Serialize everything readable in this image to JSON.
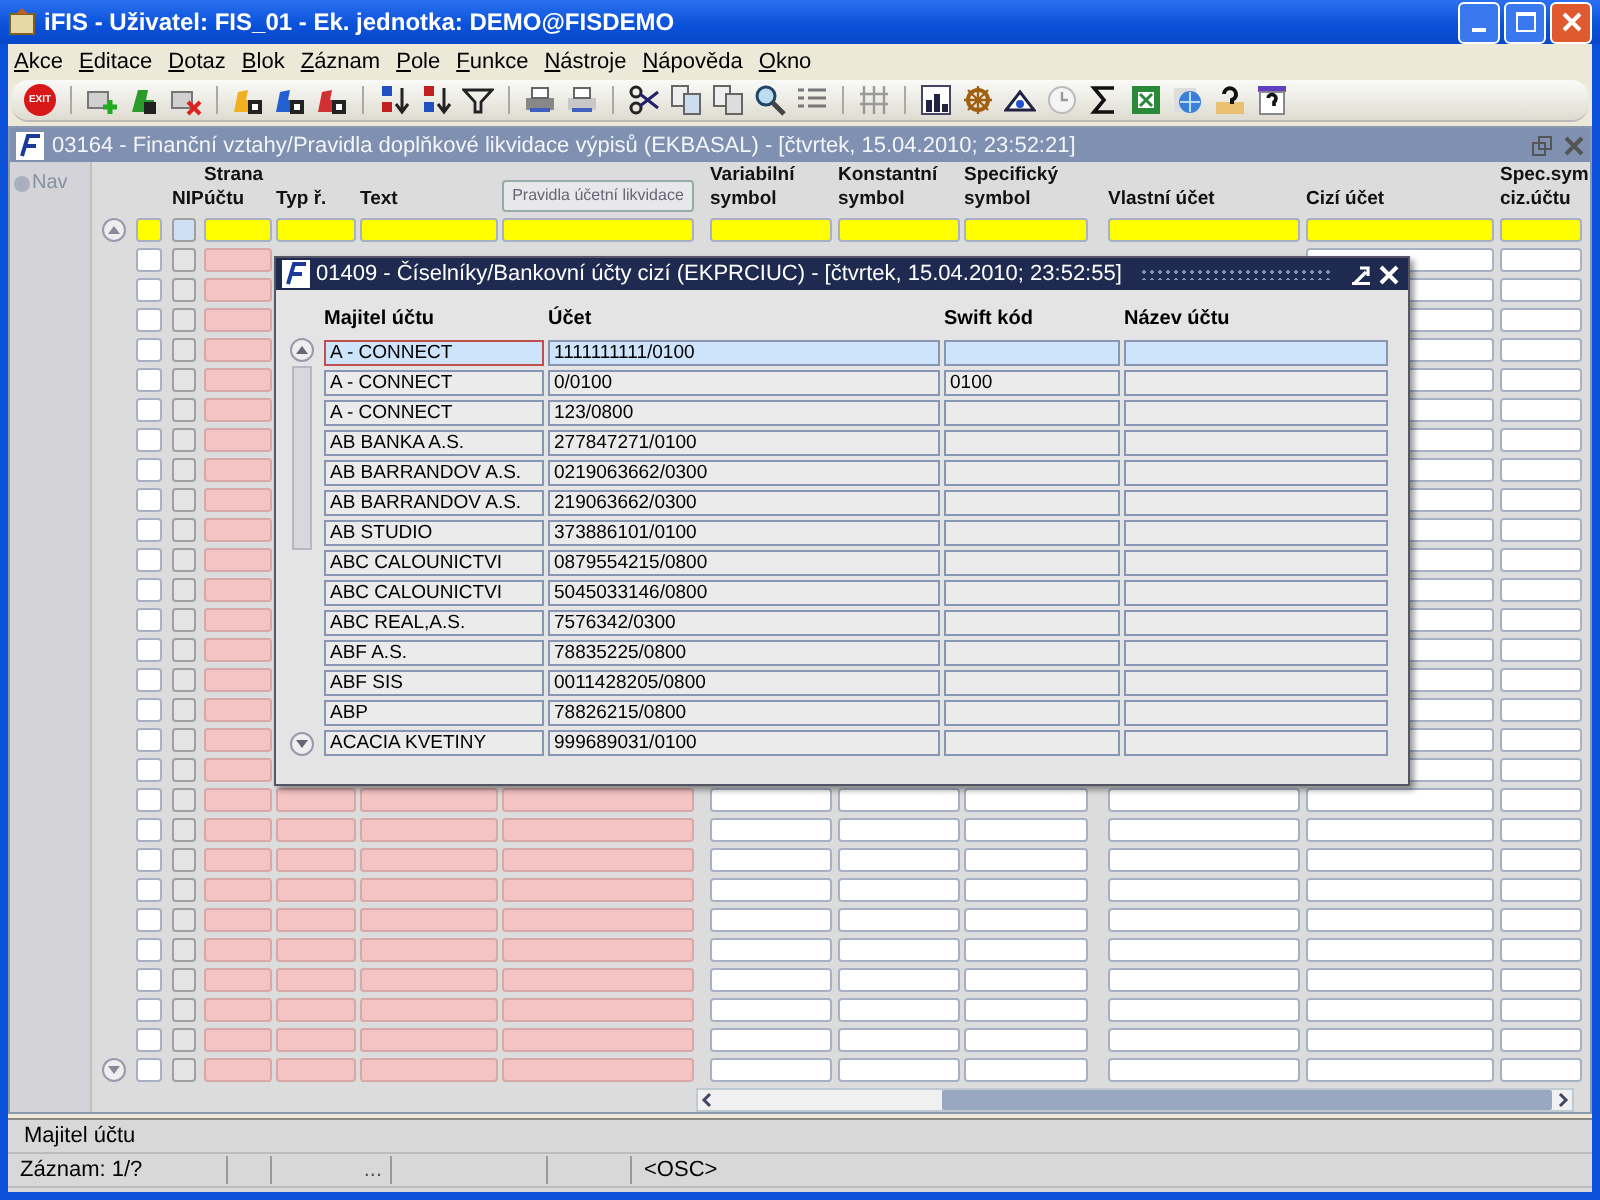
{
  "window": {
    "title": "iFIS - Uživatel: FIS_01 - Ek. jednotka: DEMO@FISDEMO"
  },
  "menu": [
    "Akce",
    "Editace",
    "Dotaz",
    "Blok",
    "Záznam",
    "Pole",
    "Funkce",
    "Nástroje",
    "Nápověda",
    "Okno"
  ],
  "toolbar": {
    "exit_label": "EXIT"
  },
  "form": {
    "title": "03164 - Finanční vztahy/Pravidla doplňkové likvidace výpisů (EKBASAL) - [čtvrtek, 15.04.2010; 23:52:21]",
    "rows": [
      {
        "checked": false
      },
      {
        "checked": false
      },
      {
        "checked": false
      },
      {
        "checked": false
      },
      {
        "checked": false
      },
      {
        "checked": false
      },
      {
        "checked": false
      },
      {
        "checked": false
      },
      {
        "checked": false
      },
      {
        "checked": false
      },
      {
        "checked": false
      },
      {
        "checked": false
      },
      {
        "checked": false
      },
      {
        "checked": false
      },
      {
        "checked": false
      },
      {
        "checked": false
      },
      {
        "checked": false
      },
      {
        "checked": false
      },
      {
        "checked": false
      },
      {
        "checked": false
      },
      {
        "checked": false
      },
      {
        "checked": false
      },
      {
        "checked": false
      },
      {
        "checked": false
      },
      {
        "checked": false
      },
      {
        "checked": false
      },
      {
        "checked": false
      },
      {
        "checked": false
      }
    ],
    "nav_label": "Nav",
    "columns": [
      {
        "label": "NIP",
        "kind": "checkbox"
      },
      {
        "label": "Strana účtu",
        "kind": "required"
      },
      {
        "label": "Typ ř.",
        "kind": "required"
      },
      {
        "label": "Text",
        "kind": "required"
      },
      {
        "label": "Pravidla účetní likvidace",
        "kind": "button"
      },
      {
        "label": "Variabilní symbol",
        "kind": "field"
      },
      {
        "label": "Konstantní symbol",
        "kind": "field"
      },
      {
        "label": "Specifický symbol",
        "kind": "field"
      },
      {
        "label": "Vlastní účet",
        "kind": "field"
      },
      {
        "label": "Cizí účet",
        "kind": "field"
      },
      {
        "label": "Spec.sym ciz.účtu",
        "kind": "field"
      }
    ]
  },
  "dialog": {
    "title": "01409 - Číselníky/Bankovní účty cizí (EKPRCIUC) - [čtvrtek, 15.04.2010; 23:52:55]",
    "columns": [
      "Majitel účtu",
      "Účet",
      "Swift kód",
      "Název účtu"
    ],
    "rows": [
      {
        "cells": [
          "A - CONNECT",
          "1111111111/0100",
          "",
          ""
        ],
        "selected": true,
        "focused": true
      },
      {
        "cells": [
          "A - CONNECT",
          "0/0100",
          "0100",
          ""
        ],
        "selected": false,
        "focused": false
      },
      {
        "cells": [
          "A - CONNECT",
          "123/0800",
          "",
          ""
        ],
        "selected": false,
        "focused": false
      },
      {
        "cells": [
          "AB BANKA A.S.",
          "277847271/0100",
          "",
          ""
        ],
        "selected": false,
        "focused": false
      },
      {
        "cells": [
          "AB BARRANDOV A.S.",
          "0219063662/0300",
          "",
          ""
        ],
        "selected": false,
        "focused": false
      },
      {
        "cells": [
          "AB BARRANDOV A.S.",
          "219063662/0300",
          "",
          ""
        ],
        "selected": false,
        "focused": false
      },
      {
        "cells": [
          "AB STUDIO",
          "373886101/0100",
          "",
          ""
        ],
        "selected": false,
        "focused": false
      },
      {
        "cells": [
          "ABC CALOUNICTVI",
          "0879554215/0800",
          "",
          ""
        ],
        "selected": false,
        "focused": false
      },
      {
        "cells": [
          "ABC CALOUNICTVI",
          "5045033146/0800",
          "",
          ""
        ],
        "selected": false,
        "focused": false
      },
      {
        "cells": [
          "ABC REAL,A.S.",
          "7576342/0300",
          "",
          ""
        ],
        "selected": false,
        "focused": false
      },
      {
        "cells": [
          "ABF A.S.",
          "78835225/0800",
          "",
          ""
        ],
        "selected": false,
        "focused": false
      },
      {
        "cells": [
          "ABF SIS",
          "0011428205/0800",
          "",
          ""
        ],
        "selected": false,
        "focused": false
      },
      {
        "cells": [
          "ABP",
          "78826215/0800",
          "",
          ""
        ],
        "selected": false,
        "focused": false
      },
      {
        "cells": [
          "ACACIA KVETINY",
          "999689031/0100",
          "",
          ""
        ],
        "selected": false,
        "focused": false
      }
    ]
  },
  "status": {
    "hint": "Majitel účtu",
    "record": "Záznam: 1/?",
    "ellipsis": "...",
    "mode": "<OSC>"
  }
}
